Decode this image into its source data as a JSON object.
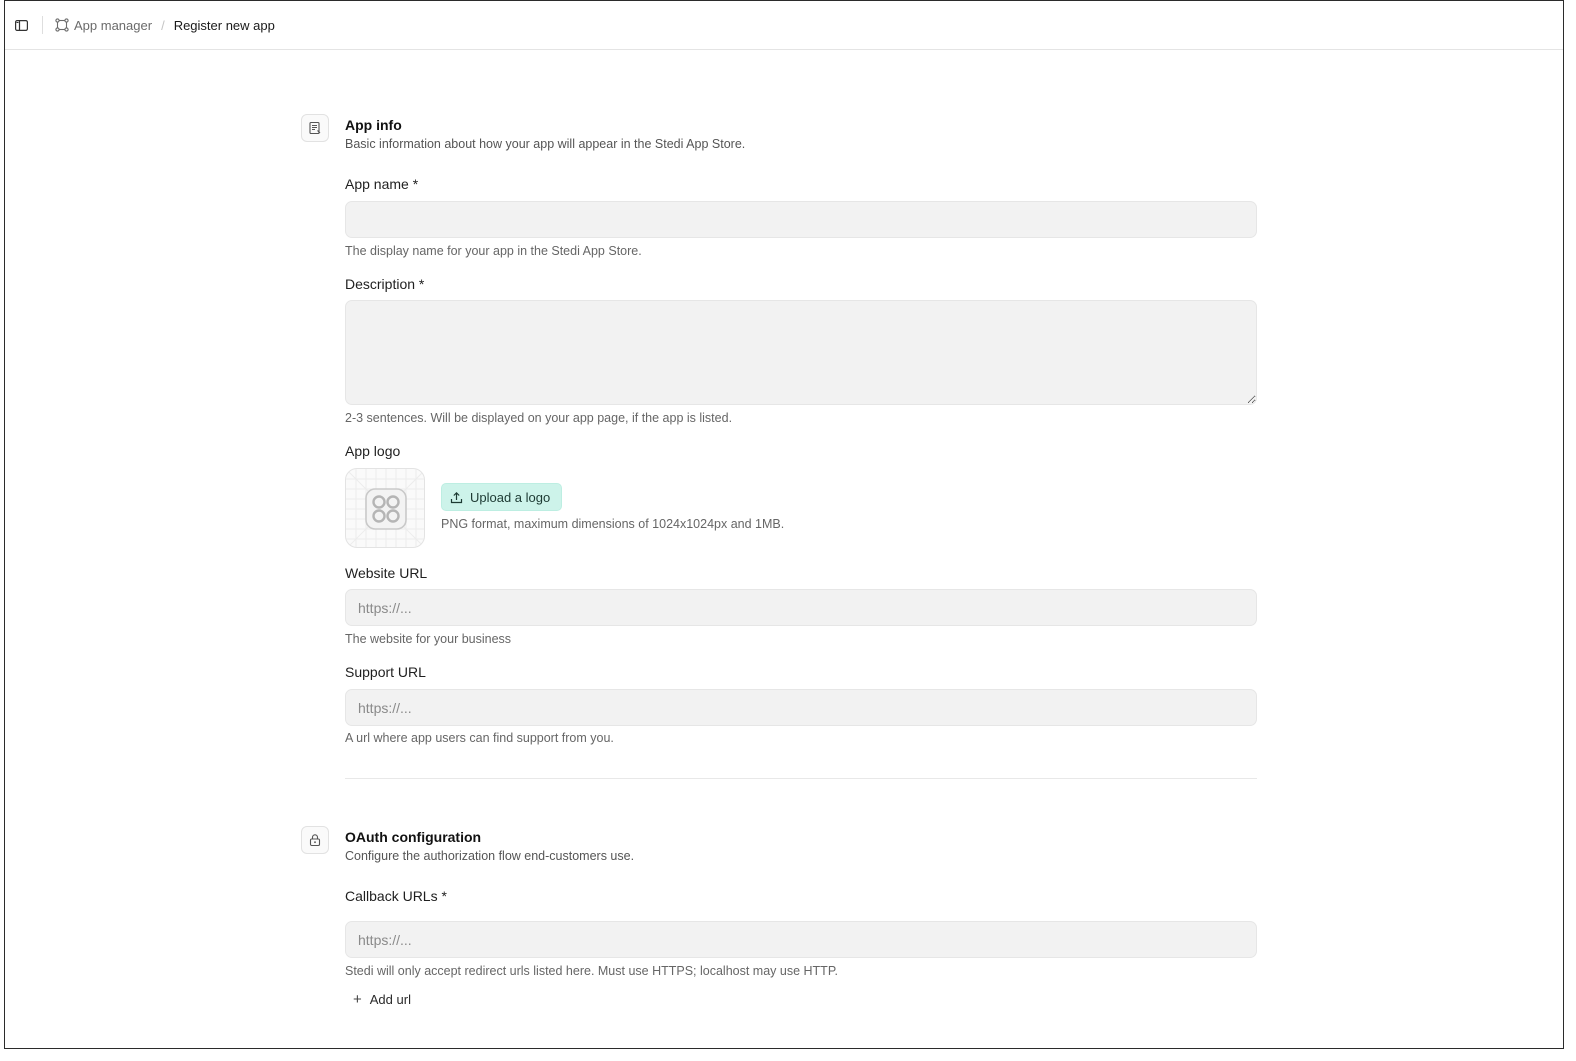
{
  "breadcrumb": {
    "parent": "App manager",
    "current": "Register new app"
  },
  "app_info": {
    "title": "App info",
    "subtitle": "Basic information about how your app will appear in the Stedi App Store.",
    "icon": "document-icon",
    "app_name": {
      "label": "App name *",
      "value": "",
      "placeholder": "",
      "help": "The display name for your app in the Stedi App Store."
    },
    "description": {
      "label": "Description *",
      "value": "",
      "placeholder": "",
      "help": "2-3 sentences. Will be displayed on your app page, if the app is listed."
    },
    "app_logo": {
      "label": "App logo",
      "upload_label": "Upload a logo",
      "help": "PNG format, maximum dimensions of 1024x1024px and 1MB."
    },
    "website_url": {
      "label": "Website URL",
      "value": "",
      "placeholder": "https://...",
      "help": "The website for your business"
    },
    "support_url": {
      "label": "Support URL",
      "value": "",
      "placeholder": "https://...",
      "help": "A url where app users can find support from you."
    }
  },
  "oauth": {
    "title": "OAuth configuration",
    "subtitle": "Configure the authorization flow end-customers use.",
    "icon": "lock-icon",
    "callback_urls": {
      "label": "Callback URLs *",
      "value": "",
      "placeholder": "https://...",
      "help": "Stedi will only accept redirect urls listed here. Must use HTTPS; localhost may use HTTP."
    },
    "add_url_label": "Add url"
  },
  "colors": {
    "accent_button_bg": "#cdf3ea",
    "input_bg": "#f2f2f2"
  }
}
